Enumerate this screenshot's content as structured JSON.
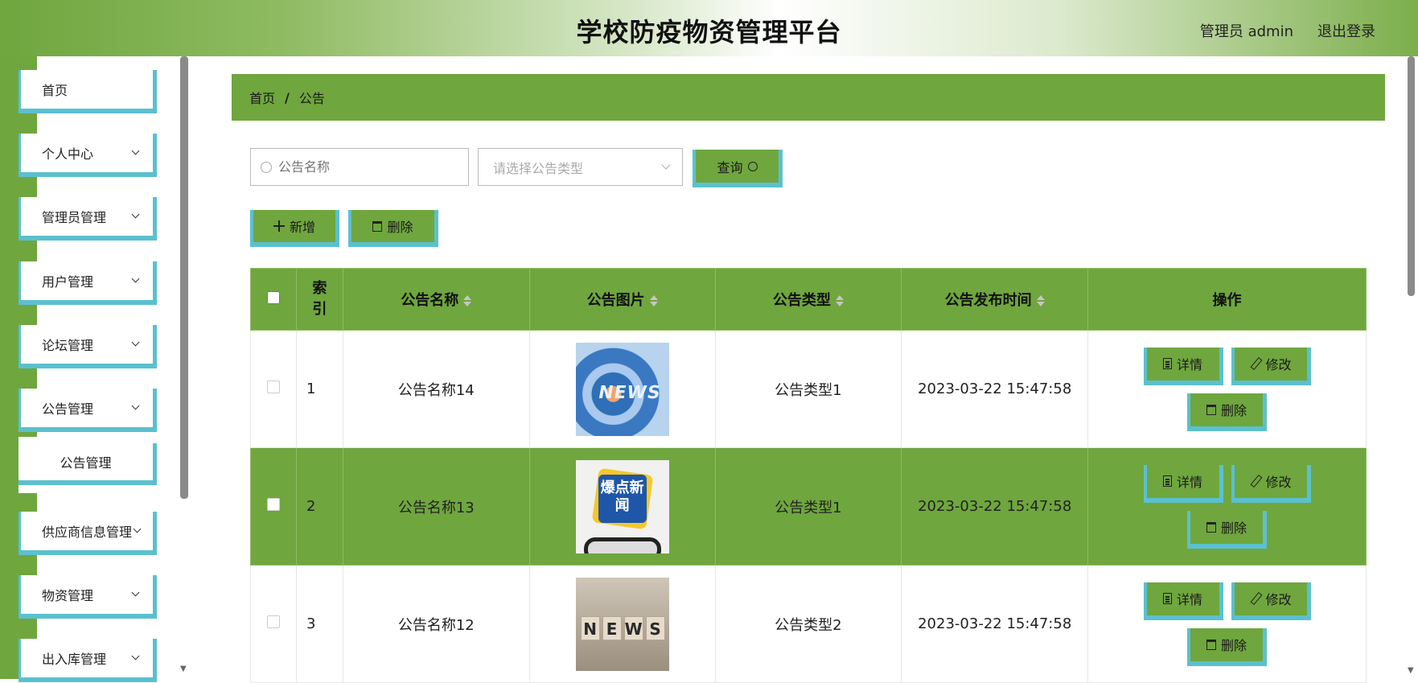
{
  "header": {
    "title": "学校防疫物资管理平台",
    "user": "管理员 admin",
    "logout": "退出登录"
  },
  "sidebar": {
    "items": [
      {
        "label": "首页",
        "expandable": false
      },
      {
        "label": "个人中心",
        "expandable": true
      },
      {
        "label": "管理员管理",
        "expandable": true
      },
      {
        "label": "用户管理",
        "expandable": true
      },
      {
        "label": "论坛管理",
        "expandable": true
      },
      {
        "label": "公告管理",
        "expandable": true
      },
      {
        "label": "供应商信息管理",
        "expandable": true
      },
      {
        "label": "物资管理",
        "expandable": true
      },
      {
        "label": "出入库管理",
        "expandable": true
      }
    ],
    "sub_item": "公告管理"
  },
  "breadcrumb": {
    "home": "首页",
    "separator": "/",
    "current": "公告"
  },
  "search": {
    "name_placeholder": "公告名称",
    "type_placeholder": "请选择公告类型",
    "query_label": "查询"
  },
  "toolbar": {
    "add_label": "新增",
    "delete_label": "删除"
  },
  "table": {
    "headers": {
      "index": "索引",
      "name": "公告名称",
      "image": "公告图片",
      "type": "公告类型",
      "time": "公告发布时间",
      "actions": "操作"
    },
    "rows": [
      {
        "index": "1",
        "name": "公告名称14",
        "type": "公告类型1",
        "time": "2023-03-22 15:47:58",
        "image": "news-globe"
      },
      {
        "index": "2",
        "name": "公告名称13",
        "type": "公告类型1",
        "time": "2023-03-22 15:47:58",
        "image": "breaking-news-phone"
      },
      {
        "index": "3",
        "name": "公告名称12",
        "type": "公告类型2",
        "time": "2023-03-22 15:47:58",
        "image": "news-cubes"
      }
    ],
    "actions": {
      "detail": "详情",
      "edit": "修改",
      "delete": "删除"
    }
  },
  "images": {
    "news_word": "NEWS",
    "breaking_text": "爆点新闻",
    "cube_letters": [
      "N",
      "E",
      "W",
      "S"
    ]
  },
  "colors": {
    "primary": "#6fa63e",
    "accent": "#5bc0cf"
  }
}
